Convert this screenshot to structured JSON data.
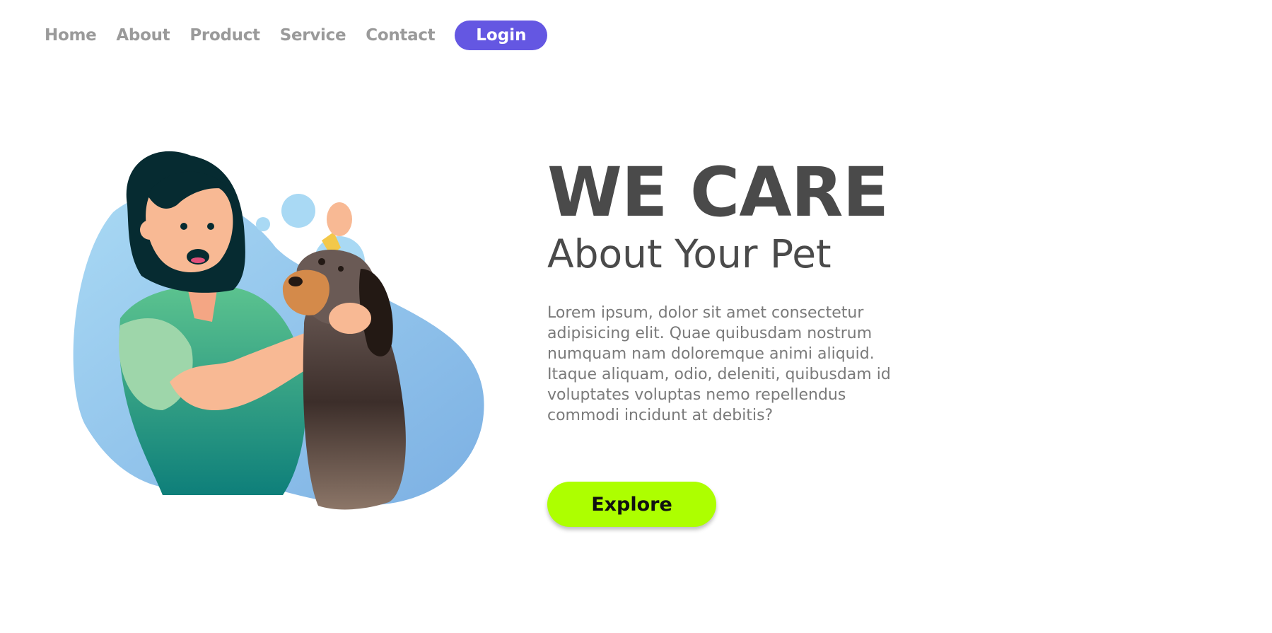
{
  "nav": {
    "items": [
      {
        "label": "Home"
      },
      {
        "label": "About"
      },
      {
        "label": "Product"
      },
      {
        "label": "Service"
      },
      {
        "label": "Contact"
      }
    ],
    "login_label": "Login"
  },
  "hero": {
    "headline": "WE CARE",
    "subheadline": "About Your Pet",
    "description": "Lorem ipsum, dolor sit amet consectetur adipisicing elit. Quae quibusdam nostrum numquam nam doloremque animi aliquid. Itaque aliquam, odio, deleniti, quibusdam id voluptates voluptas nemo repellendus commodi incidunt at debitis?",
    "cta_label": "Explore",
    "illustration_icon": "vet-with-dog-illustration"
  },
  "colors": {
    "accent": "#6457e2",
    "cta": "#adff00",
    "heading": "#4a4a4a",
    "body_text": "#7a7a7a",
    "nav_text": "#9a9a9a"
  }
}
